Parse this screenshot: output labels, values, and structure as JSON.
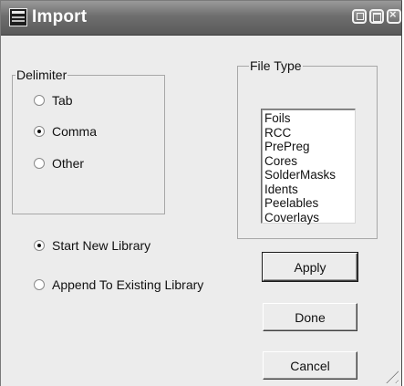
{
  "window": {
    "title": "Import",
    "icons": {
      "app": "list-window-icon",
      "minimize": "minimize-icon",
      "maximize": "maximize-icon",
      "close": "close-icon"
    }
  },
  "delimiter": {
    "label": "Delimiter",
    "options": [
      {
        "label": "Tab",
        "selected": false
      },
      {
        "label": "Comma",
        "selected": true
      },
      {
        "label": "Other",
        "selected": false
      }
    ]
  },
  "library_mode": {
    "options": [
      {
        "label": "Start New Library",
        "selected": true
      },
      {
        "label": "Append To Existing Library",
        "selected": false
      }
    ]
  },
  "file_type": {
    "label": "File Type",
    "items": [
      "Foils",
      "RCC",
      "PrePreg",
      "Cores",
      "SolderMasks",
      "Idents",
      "Peelables",
      "Coverlays"
    ]
  },
  "buttons": {
    "apply": "Apply",
    "done": "Done",
    "cancel": "Cancel"
  }
}
